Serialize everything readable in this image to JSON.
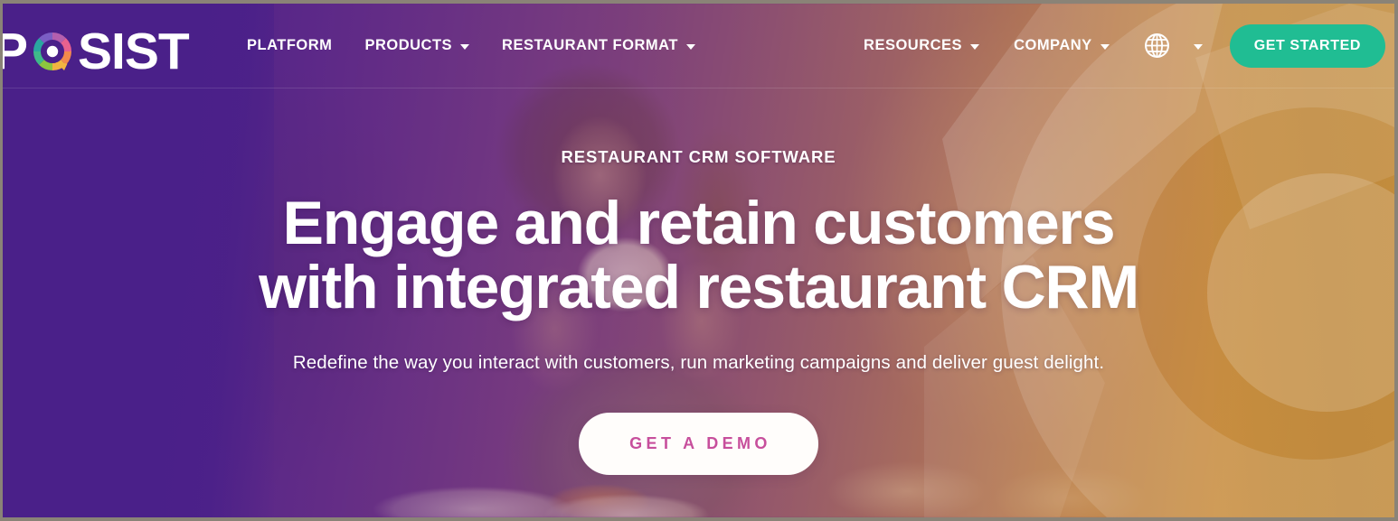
{
  "brand": {
    "name": "POSIST",
    "logo_prefix": "P",
    "logo_suffix": "SIST",
    "logo_ring_icon": "posist-donut-logo-icon",
    "ring_colors": [
      "#7b5ec4",
      "#b45fae",
      "#e8618f",
      "#f28a4c",
      "#f2b441",
      "#8cc63f",
      "#3fb98a",
      "#2aa6a0"
    ]
  },
  "colors": {
    "hero_purple": "#4a2089",
    "hero_orange": "#c28c3d",
    "cta_green": "#20bd93",
    "demo_pink": "#c74f9c",
    "text_white": "#ffffff"
  },
  "nav": {
    "left_items": [
      {
        "label": "PLATFORM",
        "has_dropdown": false
      },
      {
        "label": "PRODUCTS",
        "has_dropdown": true
      },
      {
        "label": "RESTAURANT FORMAT",
        "has_dropdown": true
      }
    ],
    "right_items": [
      {
        "label": "RESOURCES",
        "has_dropdown": true
      },
      {
        "label": "COMPANY",
        "has_dropdown": true
      }
    ],
    "language": {
      "icon": "globe-icon",
      "has_dropdown": true
    },
    "cta_label": "GET STARTED"
  },
  "hero": {
    "eyebrow": "RESTAURANT CRM SOFTWARE",
    "headline_line1": "Engage and retain customers",
    "headline_line2": "with integrated restaurant CRM",
    "subheading": "Redefine the way you interact with customers, run marketing campaigns and deliver guest delight.",
    "cta_label": "GET A DEMO",
    "background_image_description": "Woman drinking coffee at a restaurant table"
  }
}
